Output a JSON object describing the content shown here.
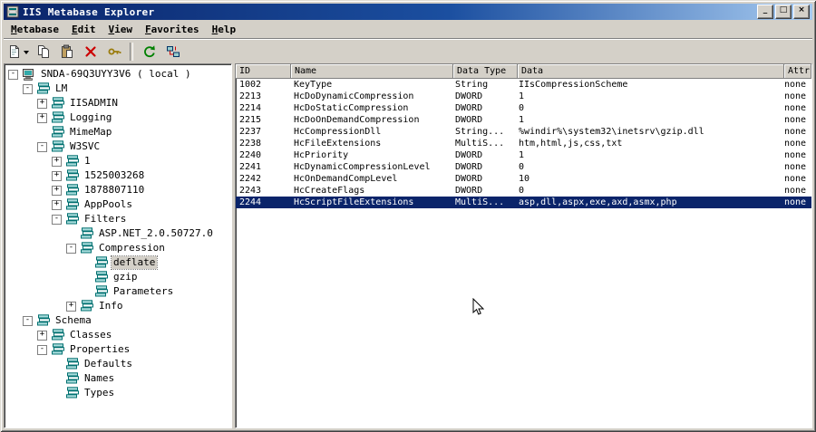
{
  "window": {
    "title": "IIS Metabase Explorer",
    "icon": "metabase-app-icon",
    "controls": [
      {
        "name": "minimize-button",
        "icon": "minimize-icon",
        "glyph": "_"
      },
      {
        "name": "maximize-button",
        "icon": "maximize-icon",
        "glyph": "□"
      },
      {
        "name": "close-button",
        "icon": "close-icon",
        "glyph": "×"
      }
    ]
  },
  "menu": {
    "items": [
      "Metabase",
      "Edit",
      "View",
      "Favorites",
      "Help"
    ]
  },
  "toolbar": {
    "buttons": [
      {
        "name": "new-key-button",
        "icon": "new-key-icon",
        "dropdown": true
      },
      {
        "name": "copy-button",
        "icon": "copy-icon"
      },
      {
        "name": "paste-button",
        "icon": "paste-icon"
      },
      {
        "name": "delete-button",
        "icon": "delete-icon"
      },
      {
        "name": "edit-key-button",
        "icon": "key-icon"
      },
      {
        "type": "separator"
      },
      {
        "name": "refresh-button",
        "icon": "refresh-icon"
      },
      {
        "name": "connect-button",
        "icon": "connect-icon"
      }
    ]
  },
  "tree": {
    "items": [
      {
        "label": "SNDA-69Q3UYY3V6 ( local )",
        "depth": 0,
        "icon": "computer-icon",
        "expander": "minus"
      },
      {
        "label": "LM",
        "depth": 1,
        "icon": "db-icon",
        "expander": "minus"
      },
      {
        "label": "IISADMIN",
        "depth": 2,
        "icon": "db-icon",
        "expander": "plus"
      },
      {
        "label": "Logging",
        "depth": 2,
        "icon": "db-icon",
        "expander": "plus"
      },
      {
        "label": "MimeMap",
        "depth": 2,
        "icon": "db-icon",
        "expander": "none"
      },
      {
        "label": "W3SVC",
        "depth": 2,
        "icon": "db-icon",
        "expander": "minus"
      },
      {
        "label": "1",
        "depth": 3,
        "icon": "db-icon",
        "expander": "plus"
      },
      {
        "label": "1525003268",
        "depth": 3,
        "icon": "db-icon",
        "expander": "plus"
      },
      {
        "label": "1878807110",
        "depth": 3,
        "icon": "db-icon",
        "expander": "plus"
      },
      {
        "label": "AppPools",
        "depth": 3,
        "icon": "db-icon",
        "expander": "plus"
      },
      {
        "label": "Filters",
        "depth": 3,
        "icon": "db-icon",
        "expander": "minus"
      },
      {
        "label": "ASP.NET_2.0.50727.0",
        "depth": 4,
        "icon": "db-icon",
        "expander": "none"
      },
      {
        "label": "Compression",
        "depth": 4,
        "icon": "db-icon",
        "expander": "minus"
      },
      {
        "label": "deflate",
        "depth": 5,
        "icon": "db-icon",
        "expander": "none",
        "selected": true
      },
      {
        "label": "gzip",
        "depth": 5,
        "icon": "db-icon",
        "expander": "none"
      },
      {
        "label": "Parameters",
        "depth": 5,
        "icon": "db-icon",
        "expander": "none"
      },
      {
        "label": "Info",
        "depth": 4,
        "icon": "db-icon",
        "expander": "plus"
      },
      {
        "label": "Schema",
        "depth": 1,
        "icon": "db-icon",
        "expander": "minus"
      },
      {
        "label": "Classes",
        "depth": 2,
        "icon": "db-icon",
        "expander": "plus"
      },
      {
        "label": "Properties",
        "depth": 2,
        "icon": "db-icon",
        "expander": "minus"
      },
      {
        "label": "Defaults",
        "depth": 3,
        "icon": "db-icon",
        "expander": "none"
      },
      {
        "label": "Names",
        "depth": 3,
        "icon": "db-icon",
        "expander": "none"
      },
      {
        "label": "Types",
        "depth": 3,
        "icon": "db-icon",
        "expander": "none"
      }
    ]
  },
  "table": {
    "columns": [
      "ID",
      "Name",
      "Data Type",
      "Data",
      "Attributes"
    ],
    "rows": [
      [
        "1002",
        "KeyType",
        "String",
        "IIsCompressionScheme",
        "none"
      ],
      [
        "2213",
        "HcDoDynamicCompression",
        "DWORD",
        "1",
        "none"
      ],
      [
        "2214",
        "HcDoStaticCompression",
        "DWORD",
        "0",
        "none"
      ],
      [
        "2215",
        "HcDoOnDemandCompression",
        "DWORD",
        "1",
        "none"
      ],
      [
        "2237",
        "HcCompressionDll",
        "String...",
        "%windir%\\system32\\inetsrv\\gzip.dll",
        "none"
      ],
      [
        "2238",
        "HcFileExtensions",
        "MultiS...",
        "htm,html,js,css,txt",
        "none"
      ],
      [
        "2240",
        "HcPriority",
        "DWORD",
        "1",
        "none"
      ],
      [
        "2241",
        "HcDynamicCompressionLevel",
        "DWORD",
        "0",
        "none"
      ],
      [
        "2242",
        "HcOnDemandCompLevel",
        "DWORD",
        "10",
        "none"
      ],
      [
        "2243",
        "HcCreateFlags",
        "DWORD",
        "0",
        "none"
      ],
      [
        "2244",
        "HcScriptFileExtensions",
        "MultiS...",
        "asp,dll,aspx,exe,axd,asmx,php",
        "none"
      ]
    ],
    "selected_row_index": 10
  },
  "colors": {
    "selection": "#0a246a",
    "titlebar_start": "#0a246a",
    "titlebar_end": "#a6caf0",
    "chrome": "#d4d0c8"
  }
}
